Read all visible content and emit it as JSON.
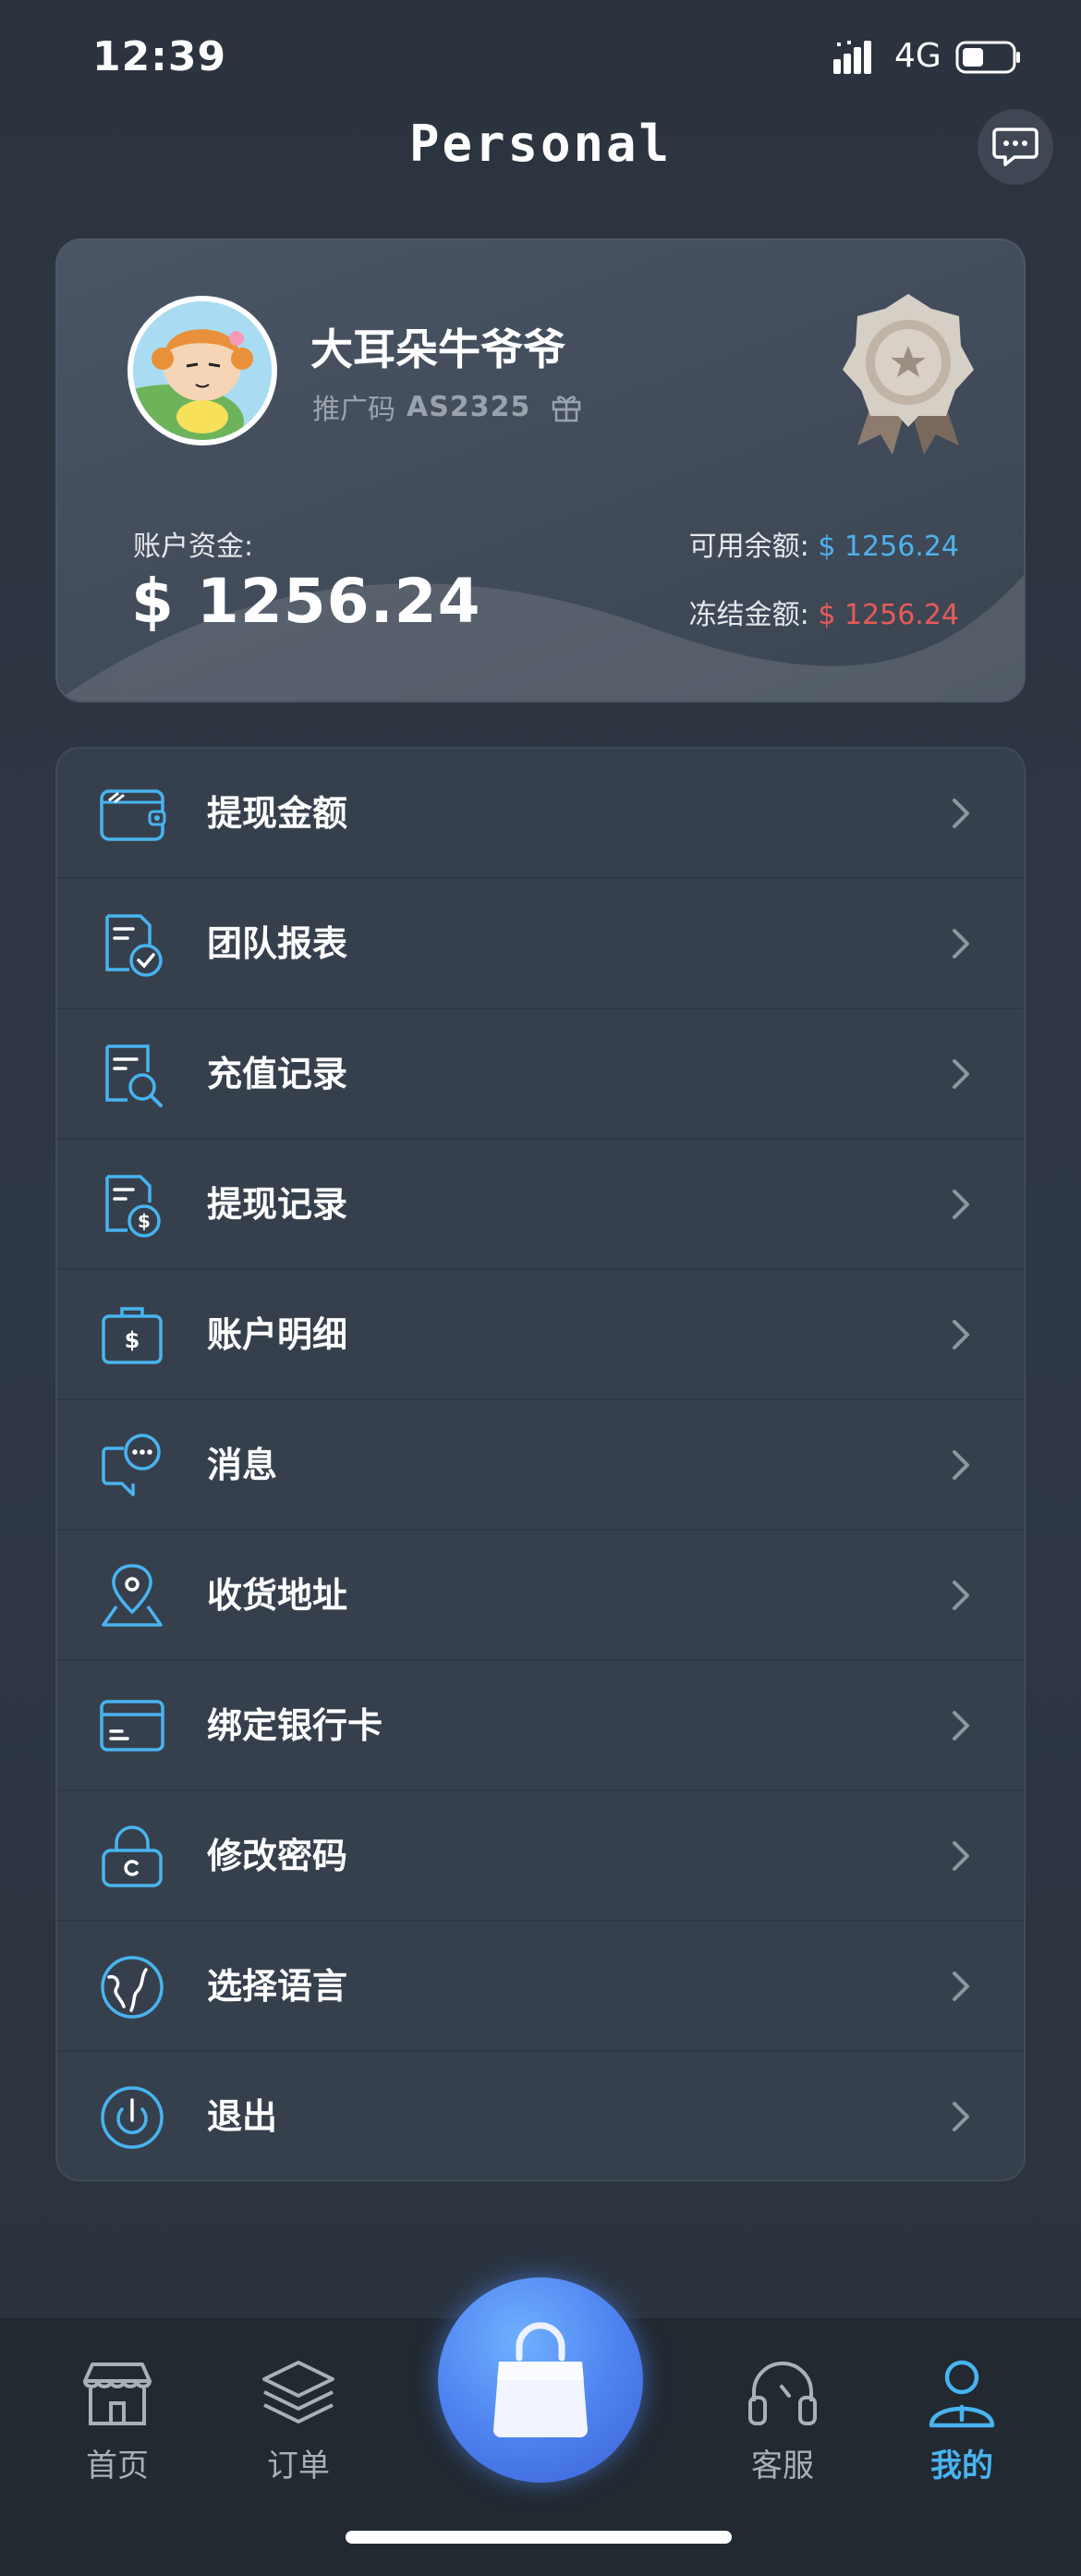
{
  "status_bar": {
    "time": "12:39",
    "network": "4G"
  },
  "header": {
    "title": "Personal"
  },
  "profile": {
    "name": "大耳朵牛爷爷",
    "promo_label": "推广码",
    "promo_code": "AS2325",
    "account_label": "账户资金:",
    "account_value": "$  1256.24",
    "available_label": "可用余额:",
    "available_value": "$ 1256.24",
    "frozen_label": "冻结金额:",
    "frozen_value": "$ 1256.24"
  },
  "menu": [
    {
      "label": "提现金额",
      "icon": "wallet-icon"
    },
    {
      "label": "团队报表",
      "icon": "report-check-icon"
    },
    {
      "label": "充值记录",
      "icon": "search-record-icon"
    },
    {
      "label": "提现记录",
      "icon": "dollar-record-icon"
    },
    {
      "label": "账户明细",
      "icon": "account-dollar-icon"
    },
    {
      "label": "消息",
      "icon": "message-icon"
    },
    {
      "label": "收货地址",
      "icon": "location-icon"
    },
    {
      "label": "绑定银行卡",
      "icon": "bank-card-icon"
    },
    {
      "label": "修改密码",
      "icon": "lock-icon"
    },
    {
      "label": "选择语言",
      "icon": "globe-icon"
    },
    {
      "label": "退出",
      "icon": "power-icon"
    }
  ],
  "bottom_nav": {
    "home": "首页",
    "orders": "订单",
    "service": "客服",
    "mine": "我的"
  },
  "colors": {
    "accent_blue": "#48b4f0",
    "frozen_red": "#e85a5a",
    "cart_blue": "#4f84f0"
  }
}
